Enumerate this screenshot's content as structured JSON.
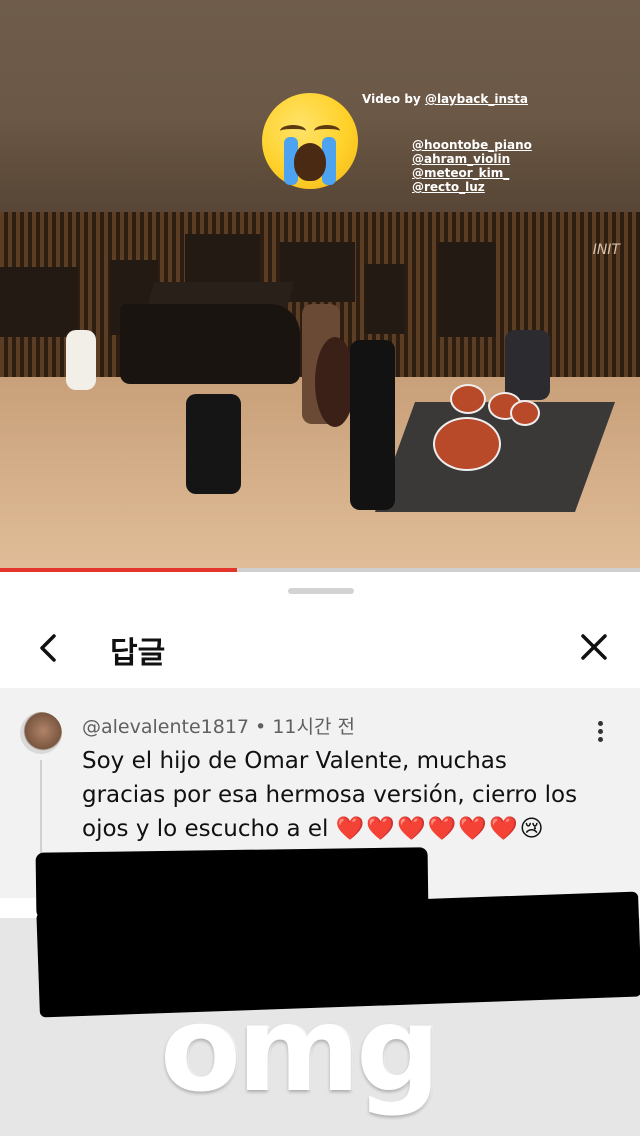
{
  "story": {
    "video_by_prefix": "Video by ",
    "video_by_handle": "@layback_insta",
    "credits": [
      "@hoontobe_piano",
      "@ahram_violin",
      "@meteor_kim_",
      "@recto_luz"
    ],
    "emoji": "loudly-crying-face",
    "sticker_text": "omg"
  },
  "video": {
    "watermark": "INIT",
    "progress_percent": 37
  },
  "sheet": {
    "title": "답글",
    "back_icon": "chevron-left-icon",
    "close_icon": "close-icon"
  },
  "comment": {
    "author": "@alevalente1817",
    "separator": " • ",
    "time": "11시간 전",
    "text": "Soy el hijo de Omar Valente, muchas gracias por esa hermosa versión, cierro los ojos y lo escucho a el",
    "emojis": "❤️❤️❤️❤️❤️❤️😢"
  },
  "colors": {
    "accent_progress": "#e3352b",
    "story_background": "#6b5846"
  }
}
